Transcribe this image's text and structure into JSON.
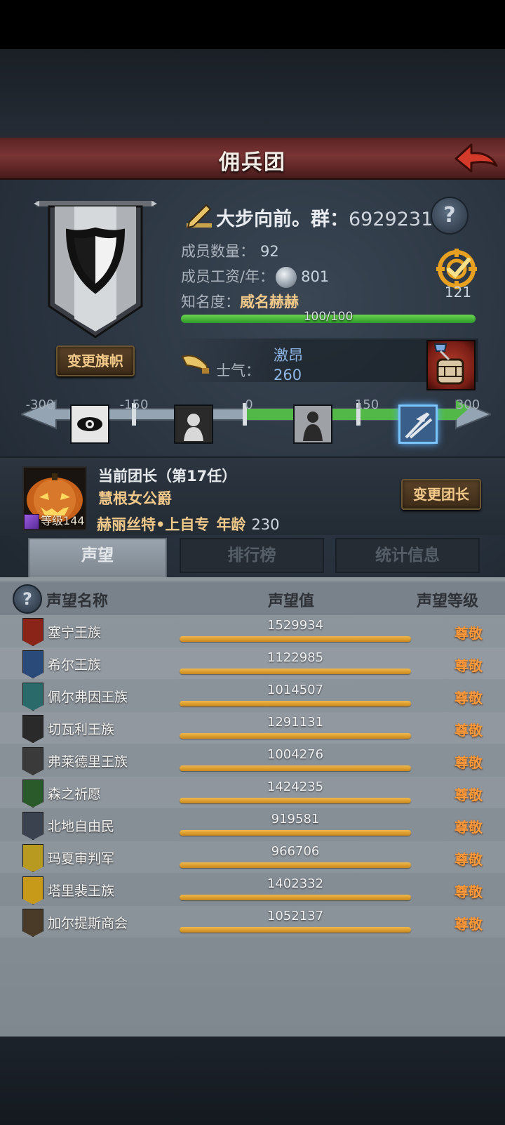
{
  "header": {
    "title": "佣兵团"
  },
  "guild": {
    "name": "大步向前。群：",
    "group_number": "69292312",
    "members_label": "成员数量：",
    "members": "92",
    "wage_label": "成员工资/年：",
    "wage": "801",
    "fame_label": "知名度：",
    "fame_rank": "威名赫赫",
    "fame_progress": "100/100",
    "fame_fraction": 1.0,
    "target_count": "121",
    "change_banner_button": "变更旗帜"
  },
  "morale": {
    "label": "士气：",
    "state": "激昂",
    "value": "260",
    "scale_min": "-300",
    "scale_m150": "-150",
    "scale_zero": "0",
    "scale_p150": "150",
    "scale_max": "300"
  },
  "leader": {
    "title": "当前团长（第17任）",
    "rank": "慧根女公爵",
    "name": "赫丽丝特•上自专",
    "age_label": "年龄",
    "age": "230",
    "level_label": "等级",
    "level": "144",
    "change_button": "变更团长"
  },
  "tabs": [
    "声望",
    "排行榜",
    "统计信息"
  ],
  "list": {
    "col_name": "声望名称",
    "col_value": "声望值",
    "col_level": "声望等级",
    "rows": [
      {
        "name": "塞宁王族",
        "value": "1529934",
        "level": "尊敬",
        "color": "#8a2418"
      },
      {
        "name": "希尔王族",
        "value": "1122985",
        "level": "尊敬",
        "color": "#2a4a7a"
      },
      {
        "name": "佩尔弗因王族",
        "value": "1014507",
        "level": "尊敬",
        "color": "#2a6a6a"
      },
      {
        "name": "切瓦利王族",
        "value": "1291131",
        "level": "尊敬",
        "color": "#2a2a2a"
      },
      {
        "name": "弗莱德里王族",
        "value": "1004276",
        "level": "尊敬",
        "color": "#3a3a3a"
      },
      {
        "name": "森之祈愿",
        "value": "1424235",
        "level": "尊敬",
        "color": "#2a5a2a"
      },
      {
        "name": "北地自由民",
        "value": "919581",
        "level": "尊敬",
        "color": "#3a4250"
      },
      {
        "name": "玛夏审判军",
        "value": "966706",
        "level": "尊敬",
        "color": "#b89a20"
      },
      {
        "name": "塔里裴王族",
        "value": "1402332",
        "level": "尊敬",
        "color": "#c89a1a"
      },
      {
        "name": "加尔提斯商会",
        "value": "1052137",
        "level": "尊敬",
        "color": "#4a3a28"
      }
    ]
  }
}
